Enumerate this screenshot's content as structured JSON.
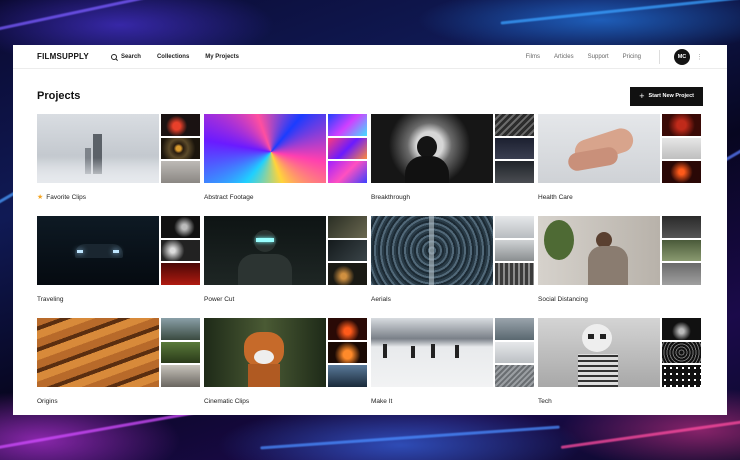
{
  "app": {
    "logo": "FILMSUPPLY"
  },
  "nav": {
    "search_label": "Search",
    "collections_label": "Collections",
    "my_projects_label": "My Projects",
    "films_label": "Films",
    "articles_label": "Articles",
    "support_label": "Support",
    "pricing_label": "Pricing",
    "avatar_initials": "MC"
  },
  "header": {
    "title": "Projects",
    "new_project_label": "Start New Project"
  },
  "projects": [
    {
      "name": "Favorite Clips",
      "starred": true
    },
    {
      "name": "Abstract Footage",
      "starred": false
    },
    {
      "name": "Breakthrough",
      "starred": false
    },
    {
      "name": "Health Care",
      "starred": false
    },
    {
      "name": "Traveling",
      "starred": false
    },
    {
      "name": "Power Cut",
      "starred": false
    },
    {
      "name": "Aerials",
      "starred": false
    },
    {
      "name": "Social Distancing",
      "starred": false
    },
    {
      "name": "Origins",
      "starred": false
    },
    {
      "name": "Cinematic Clips",
      "starred": false
    },
    {
      "name": "Make It",
      "starred": false
    },
    {
      "name": "Tech",
      "starred": false
    }
  ],
  "colors": {
    "accent": "#111111",
    "star": "#f5a623"
  }
}
